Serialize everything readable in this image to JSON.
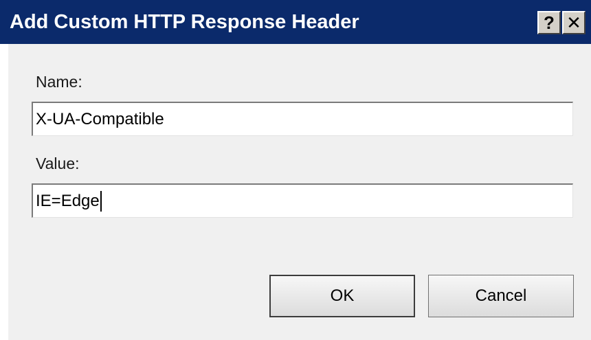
{
  "window": {
    "title": "Add Custom HTTP Response Header",
    "help_label": "?",
    "close_label": "✕"
  },
  "form": {
    "name_label": "Name:",
    "name_value": "X-UA-Compatible",
    "value_label": "Value:",
    "value_value": "IE=Edge"
  },
  "buttons": {
    "ok_label": "OK",
    "cancel_label": "Cancel"
  },
  "colors": {
    "titlebar": "#0b2a6b",
    "dialog_background": "#f0f0f0"
  },
  "icons": {
    "help": "question-mark-icon",
    "close": "close-icon"
  }
}
